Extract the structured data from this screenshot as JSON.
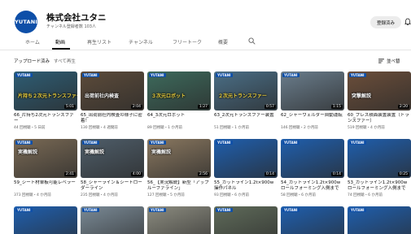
{
  "channel": {
    "logo_text": "YUTANI",
    "name": "株式会社ユタニ",
    "subscribers": "チャンネル登録者数 103人",
    "subscribe_label": "登録済み"
  },
  "tabs": [
    {
      "label": "ホーム"
    },
    {
      "label": "動画"
    },
    {
      "label": "再生リスト"
    },
    {
      "label": "チャンネル"
    },
    {
      "label": "フリートーク"
    },
    {
      "label": "概要"
    }
  ],
  "filter": {
    "label": "アップロード済み",
    "secondary": "すべて再生"
  },
  "sort_label": "並べ替",
  "videos": [
    {
      "title": "66_片持ち2次元トランスファー",
      "meta": "44 回視聴・5 日前",
      "duration": "5:01",
      "overlay": "片持ち２次元トランスファー",
      "bg": "#2e5d74",
      "ov_color": "#f2d640"
    },
    {
      "title": "65_出荷前社内検査の様子に密着！",
      "meta": "130 回視聴・4 週間前",
      "duration": "2:04",
      "overlay": "出荷前社内検査",
      "bg": "#5c4b3a",
      "ov_color": "#ffffff"
    },
    {
      "title": "64_3次元ロボット",
      "meta": "89 回視聴・1 か月前",
      "duration": "1:27",
      "overlay": "３次元ロボット",
      "bg": "#3d6a5c",
      "ov_color": "#f2d640"
    },
    {
      "title": "63_2次元トランスファー装置",
      "meta": "51 回視聴・1 か月前",
      "duration": "0:57",
      "overlay": "２次元トランスファー",
      "bg": "#4a6e86",
      "ov_color": "#f2d640"
    },
    {
      "title": "62_シャーウェルダー自動運転",
      "meta": "146 回視聴・2 か月前",
      "duration": "1:15",
      "overlay": "",
      "bg": "#6a7d8c",
      "ov_color": "#ffffff"
    },
    {
      "title": "60_プレス積面装置装置（トランスファー）",
      "meta": "519 回視聴・4 か月前",
      "duration": "2:20",
      "overlay": "突撃解説",
      "bg": "#6b4e3a",
      "ov_color": "#ffffff"
    },
    {
      "title": "59_シート材単板可能レベラー",
      "meta": "373 回視聴・4 か月前",
      "duration": "2:41",
      "overlay": "実機解説",
      "bg": "#7a6a55",
      "ov_color": "#ffffff"
    },
    {
      "title": "58_シャーライン＆シートローダーライン",
      "meta": "235 回視聴・4 か月前",
      "duration": "4:00",
      "overlay": "実機解説",
      "bg": "#4f5e6a",
      "ov_color": "#ffffff"
    },
    {
      "title": "56_【実況解説】新型「アップルーファライン」",
      "meta": "127 回視聴・5 か月前",
      "duration": "2:56",
      "overlay": "実機解説",
      "bg": "#8a7860",
      "ov_color": "#ffffff"
    },
    {
      "title": "55_カットライン1.2t×900w操作パネル",
      "meta": "93 回視聴・6 か月前",
      "duration": "0:14",
      "overlay": "",
      "bg": "#1f5fae",
      "ov_color": "#ffffff"
    },
    {
      "title": "54_カットライン1.2t×900wロールフォーミング入側まで",
      "meta": "58 回視聴・6 か月前",
      "duration": "0:14",
      "overlay": "",
      "bg": "#1f5fae",
      "ov_color": "#ffffff"
    },
    {
      "title": "53_カットライン1.2t×900wロールフォーミング入側まで",
      "meta": "74 回視聴・6 か月前",
      "duration": "0:25",
      "overlay": "",
      "bg": "#1f5fae",
      "ov_color": "#ffffff"
    },
    {
      "title": "",
      "meta": "",
      "duration": "",
      "overlay": "",
      "bg": "#1f5fae",
      "ov_color": "#ffffff"
    },
    {
      "title": "",
      "meta": "",
      "duration": "",
      "overlay": "",
      "bg": "#7a8a96",
      "ov_color": "#ffffff"
    },
    {
      "title": "",
      "meta": "",
      "duration": "",
      "overlay": "",
      "bg": "#8c8c80",
      "ov_color": "#ffffff"
    },
    {
      "title": "",
      "meta": "",
      "duration": "",
      "overlay": "",
      "bg": "#5f6b5a",
      "ov_color": "#ffffff"
    },
    {
      "title": "",
      "meta": "",
      "duration": "",
      "overlay": "",
      "bg": "#1f5fae",
      "ov_color": "#ffffff"
    },
    {
      "title": "",
      "meta": "",
      "duration": "",
      "overlay": "",
      "bg": "#1f5fae",
      "ov_color": "#ffffff"
    }
  ]
}
